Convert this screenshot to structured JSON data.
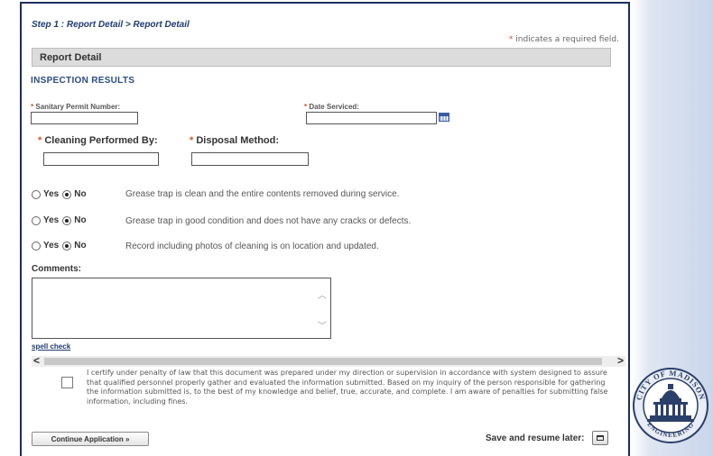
{
  "header": {
    "step_prefix": "Step 1 : ",
    "step_title": "Report Detail > Report Detail",
    "required_star": "*",
    "required_note": "indicates a required field."
  },
  "section": {
    "title": "Report Detail"
  },
  "inspection": {
    "title": "INSPECTION RESULTS"
  },
  "fields": {
    "star": "*",
    "sanitary_permit_label": "Sanitary Permit Number:",
    "sanitary_permit_value": "",
    "date_serviced_label": "Date Serviced:",
    "date_serviced_value": "",
    "cleaning_label": "Cleaning Performed By:",
    "cleaning_value": "",
    "disposal_label": "Disposal Method:",
    "disposal_value": ""
  },
  "questions": [
    {
      "yes": "Yes",
      "no": "No",
      "selected": "No",
      "text": "Grease trap is  clean and the entire contents removed during service."
    },
    {
      "yes": "Yes",
      "no": "No",
      "selected": "No",
      "text": "Grease trap in good condition and does not have any cracks or defects."
    },
    {
      "yes": "Yes",
      "no": "No",
      "selected": "No",
      "text": "Record including photos of cleaning is on location and updated."
    }
  ],
  "comments": {
    "label": "Comments:",
    "value": "",
    "spell_check": "spell check"
  },
  "scroll": {
    "left_arrow": "<",
    "right_arrow": ">"
  },
  "certify": {
    "checked": false,
    "text": "I certify under penalty of law that this document was prepared under my direction or supervision in accordance with system designed to assure that qualified personnel properly gather and evaluated the information submitted.  Based on my inquiry of the person responsible for gathering the information submitted is, to the best of my knowledge and belief, true, accurate, and complete. I am aware of penalties for submitting false information, including fines."
  },
  "footer": {
    "continue_label": "Continue Application »",
    "save_label": "Save and resume later:"
  },
  "seal": {
    "top_text": "CITY OF MADISON",
    "bottom_text": "ENGINEERING",
    "icon": "capitol-seal-icon"
  },
  "colors": {
    "accent": "#1f3a72",
    "required": "#d9531e",
    "section_bg": "#dcdcdc"
  }
}
